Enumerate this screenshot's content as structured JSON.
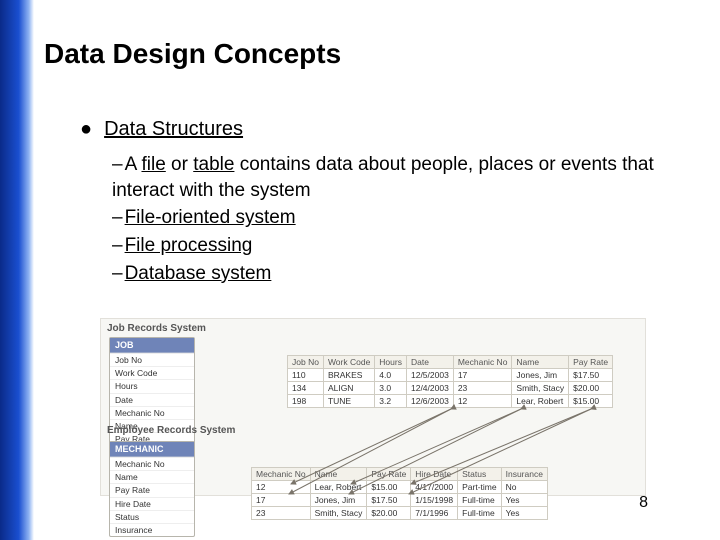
{
  "slide": {
    "title": "Data Design Concepts",
    "pageNumber": "8"
  },
  "bullet": {
    "label": "Data Structures"
  },
  "sub": {
    "line1_prefix": "A ",
    "line1_file": "file",
    "line1_mid": " or ",
    "line1_table": "table",
    "line1_rest": " contains data about people, places or events that interact with the system",
    "line2": "File-oriented system",
    "line3": "File processing",
    "line4": "Database system"
  },
  "figure": {
    "jobSection": "Job Records System",
    "empSection": "Employee Records System",
    "jobPanel": {
      "header": "JOB",
      "fields": [
        "Job No",
        "Work Code",
        "Hours",
        "Date",
        "Mechanic No",
        "Name",
        "Pay Rate"
      ]
    },
    "mechPanel": {
      "header": "MECHANIC",
      "fields": [
        "Mechanic No",
        "Name",
        "Pay Rate",
        "Hire Date",
        "Status",
        "Insurance"
      ]
    },
    "jobTable": {
      "cols": [
        "Job No",
        "Work Code",
        "Hours",
        "Date",
        "Mechanic No",
        "Name",
        "Pay Rate"
      ],
      "rows": [
        [
          "110",
          "BRAKES",
          "4.0",
          "12/5/2003",
          "17",
          "Jones, Jim",
          "$17.50"
        ],
        [
          "134",
          "ALIGN",
          "3.0",
          "12/4/2003",
          "23",
          "Smith, Stacy",
          "$20.00"
        ],
        [
          "198",
          "TUNE",
          "3.2",
          "12/6/2003",
          "12",
          "Lear, Robert",
          "$15.00"
        ]
      ]
    },
    "mechTable": {
      "cols": [
        "Mechanic No",
        "Name",
        "Pay Rate",
        "Hire Date",
        "Status",
        "Insurance"
      ],
      "rows": [
        [
          "12",
          "Lear, Robert",
          "$15.00",
          "4/17/2000",
          "Part-time",
          "No"
        ],
        [
          "17",
          "Jones, Jim",
          "$17.50",
          "1/15/1998",
          "Full-time",
          "Yes"
        ],
        [
          "23",
          "Smith, Stacy",
          "$20.00",
          "7/1/1996",
          "Full-time",
          "Yes"
        ]
      ]
    }
  }
}
